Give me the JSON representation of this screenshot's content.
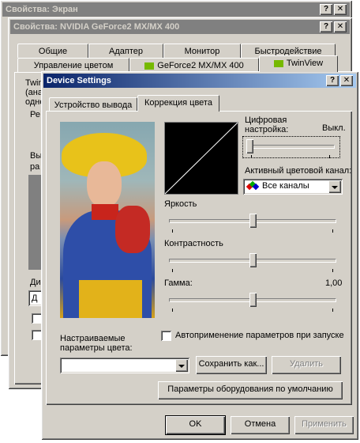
{
  "back_window": {
    "title": "Свойства: Экран"
  },
  "mid_window": {
    "title": "Свойства: NVIDIA GeForce2 MX/MX 400",
    "tabs_row1": [
      "Общие",
      "Адаптер",
      "Монитор",
      "Быстродействие"
    ],
    "tabs_row2": [
      "Управление цветом",
      "GeForce2 MX/MX 400",
      "TwinView"
    ],
    "bg_text": [
      "Twin",
      "(ана",
      "одно",
      "Ре",
      "Вы",
      "ра",
      "Ди",
      "Д"
    ]
  },
  "dialog": {
    "title": "Device Settings",
    "help_btn": "?",
    "close_btn": "✕",
    "tabs": [
      "Устройство вывода",
      "Коррекция цвета"
    ],
    "digital_label": "Цифровая настройка:",
    "digital_value": "Выкл.",
    "digital_level": 0.0,
    "channel_label": "Активный цветовой канал:",
    "channel_value": "Все каналы",
    "brightness_label": "Яркость",
    "brightness_level": 0.5,
    "contrast_label": "Контрастность",
    "contrast_level": 0.5,
    "gamma_label": "Гамма:",
    "gamma_value": "1,00",
    "gamma_level": 0.5,
    "autoapply_label": "Автоприменение параметров при запуске",
    "presets_label": "Настраиваемые параметры цвета:",
    "presets_value": "",
    "save_btn": "Сохранить как...",
    "delete_btn": "Удалить",
    "defaults_btn": "Параметры оборудования по умолчанию",
    "ok_btn": "OK",
    "cancel_btn": "Отмена",
    "apply_btn": "Применить"
  },
  "colors": {
    "title_active": "#0a246a",
    "title_inactive": "#808080",
    "face": "#d4d0c8"
  }
}
